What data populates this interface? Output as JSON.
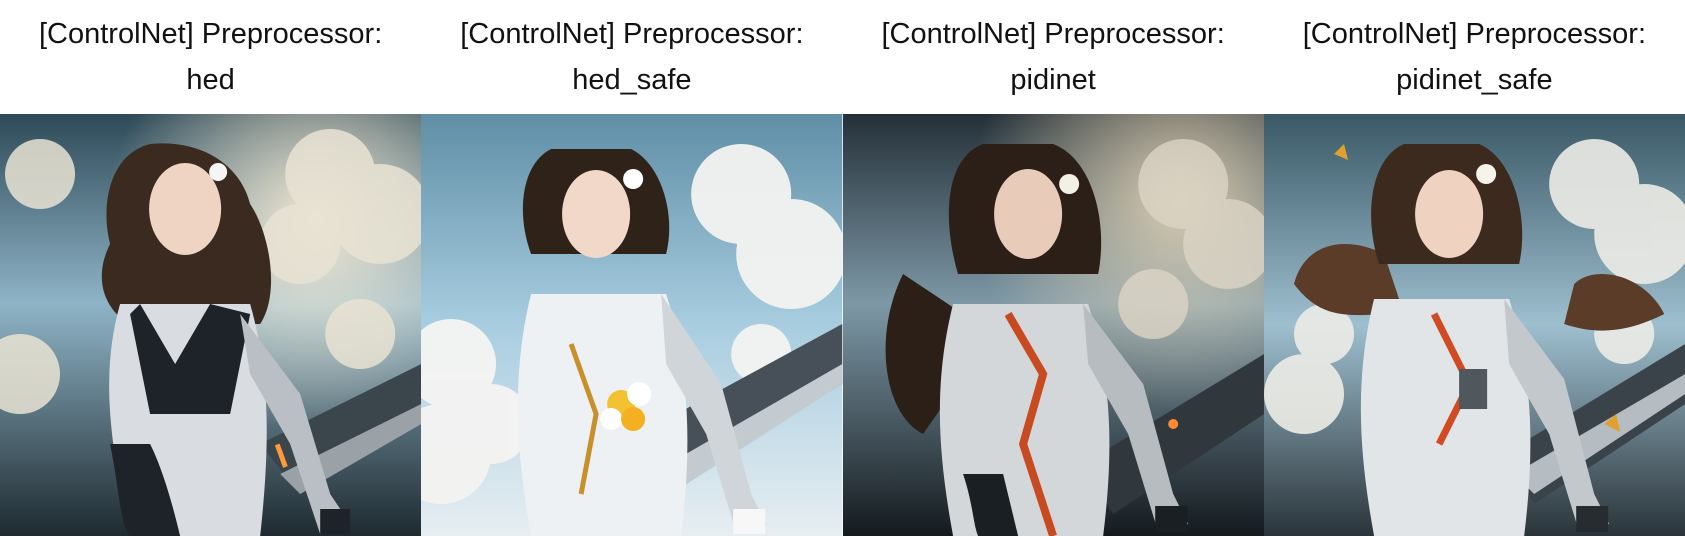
{
  "panels": [
    {
      "caption_line1": "[ControlNet] Preprocessor:",
      "caption_line2": "hed",
      "accent": "#6a4a2a",
      "sky": "#8fb4c7",
      "suit": "#d9dde2"
    },
    {
      "caption_line1": "[ControlNet] Preprocessor:",
      "caption_line2": "hed_safe",
      "accent": "#c8902a",
      "sky": "#a8cde0",
      "suit": "#eef1f4"
    },
    {
      "caption_line1": "[ControlNet] Preprocessor:",
      "caption_line2": "pidinet",
      "accent": "#c84a20",
      "sky": "#7d98a6",
      "suit": "#d3d7da"
    },
    {
      "caption_line1": "[ControlNet] Preprocessor:",
      "caption_line2": "pidinet_safe",
      "accent": "#d04a22",
      "sky": "#9ebfcf",
      "suit": "#e2e5e8"
    }
  ]
}
